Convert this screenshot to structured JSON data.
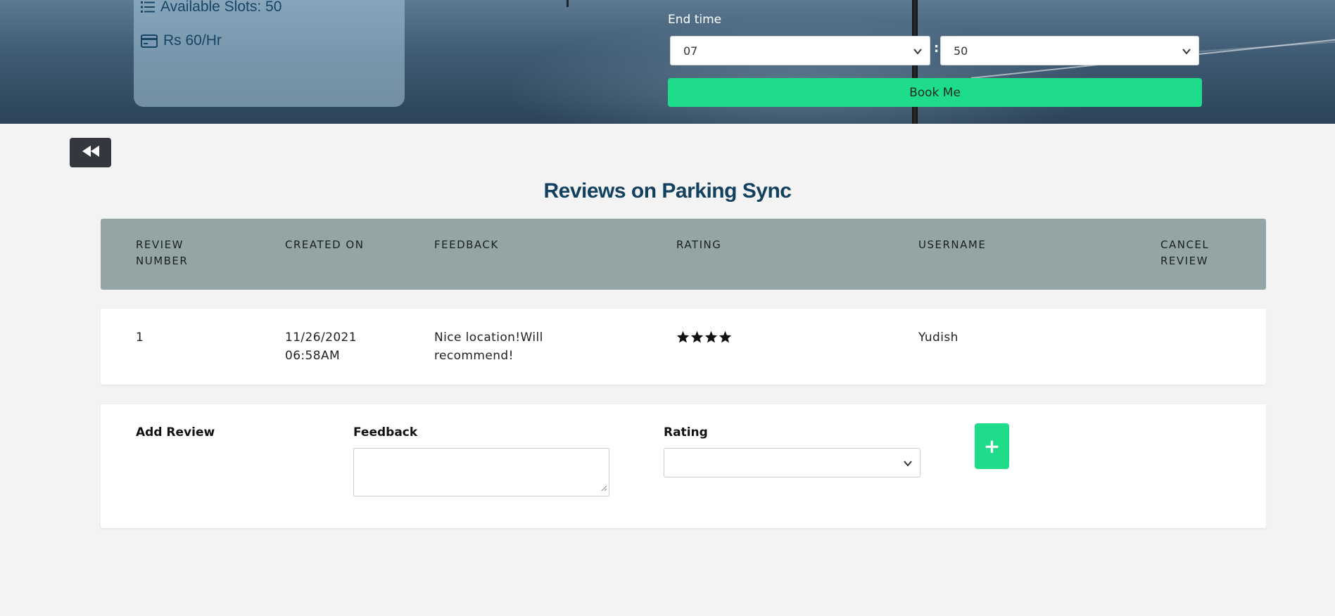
{
  "hero": {
    "available_slots": "Available Slots: 50",
    "price": "Rs 60/Hr",
    "end_time_label": "End time",
    "hour_value": "07",
    "minute_value": "50",
    "colon": ":",
    "book_button": "Book Me"
  },
  "reviews": {
    "title": "Reviews on Parking Sync",
    "columns": [
      "Review Number",
      "Created On",
      "Feedback",
      "Rating",
      "Username",
      "Cancel Review"
    ],
    "rows": [
      {
        "number": "1",
        "created_on": "11/26/2021 06:58AM",
        "feedback": "Nice location!Will recommend!",
        "rating": 4,
        "username": "Yudish"
      }
    ]
  },
  "add_review": {
    "heading": "Add Review",
    "feedback_label": "Feedback",
    "rating_label": "Rating",
    "feedback_value": "",
    "rating_value": "",
    "add_button": "+"
  },
  "icons": {
    "back": "backward-icon",
    "slots": "list-icon",
    "price": "credit-card-icon",
    "star": "star-icon",
    "add": "plus-icon"
  },
  "colors": {
    "accent_green": "#1fdc8b",
    "title_blue": "#11415f",
    "table_header": "#94a5a5",
    "back_button": "#34373d"
  }
}
